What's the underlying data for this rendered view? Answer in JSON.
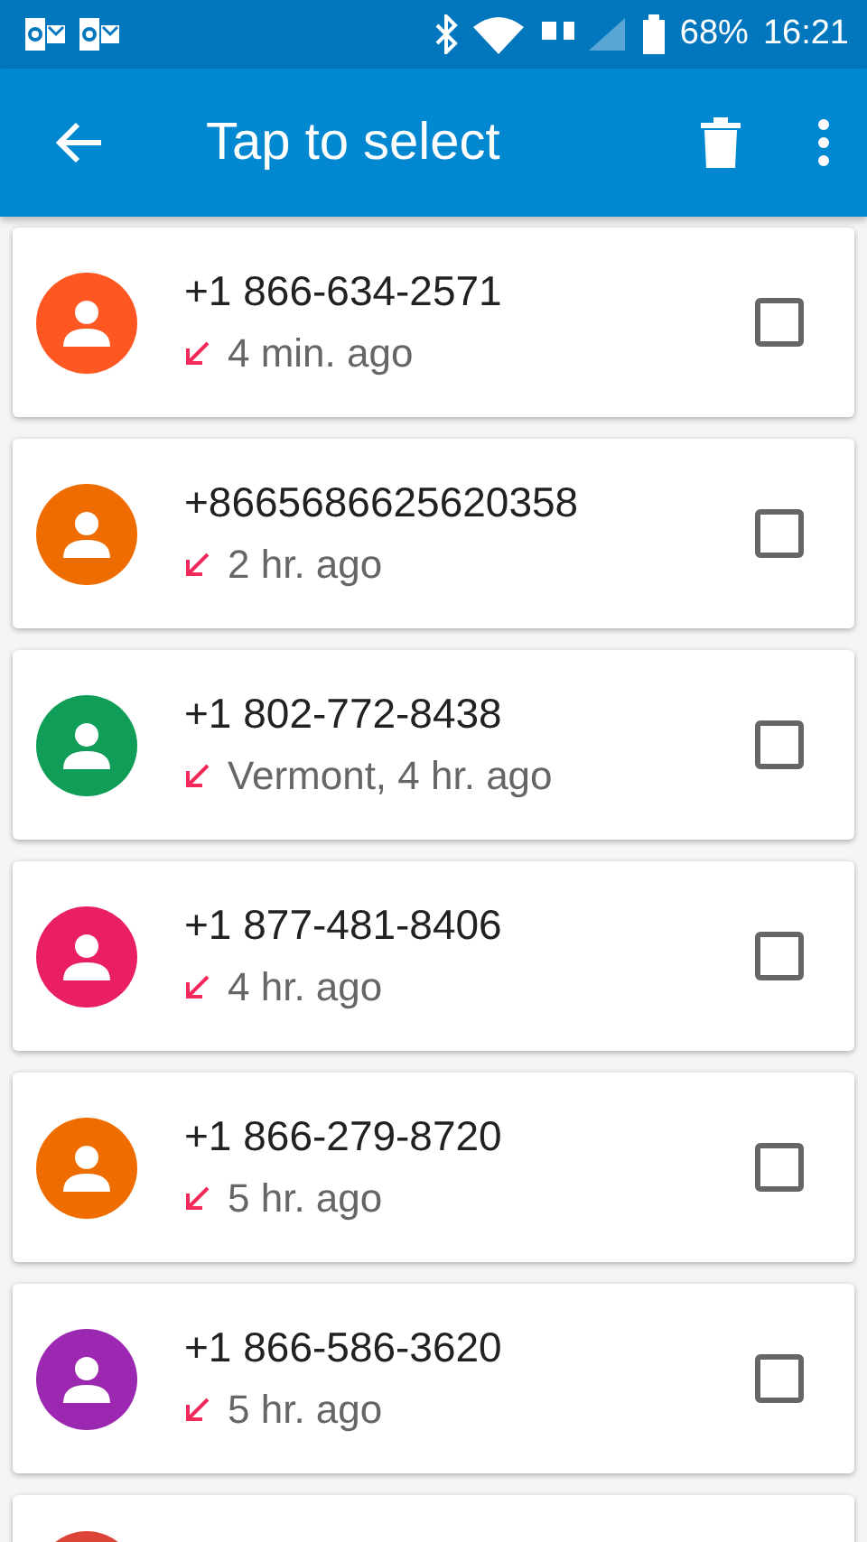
{
  "status_bar": {
    "battery": "68%",
    "time": "16:21"
  },
  "toolbar": {
    "title": "Tap to select"
  },
  "calls": [
    {
      "number": "+1 866-634-2571",
      "detail": "4 min. ago",
      "color": "#ff5722",
      "checked": false
    },
    {
      "number": "+8665686625620358",
      "detail": "2 hr. ago",
      "color": "#ef6c00",
      "checked": false
    },
    {
      "number": "+1 802-772-8438",
      "detail": "Vermont, 4 hr. ago",
      "color": "#0f9d58",
      "checked": false
    },
    {
      "number": "+1 877-481-8406",
      "detail": "4 hr. ago",
      "color": "#e91e63",
      "checked": false
    },
    {
      "number": "+1 866-279-8720",
      "detail": "5 hr. ago",
      "color": "#ef6c00",
      "checked": false
    },
    {
      "number": "+1 866-586-3620",
      "detail": "5 hr. ago",
      "color": "#9c27b0",
      "checked": false
    },
    {
      "color": "#db4437"
    }
  ]
}
